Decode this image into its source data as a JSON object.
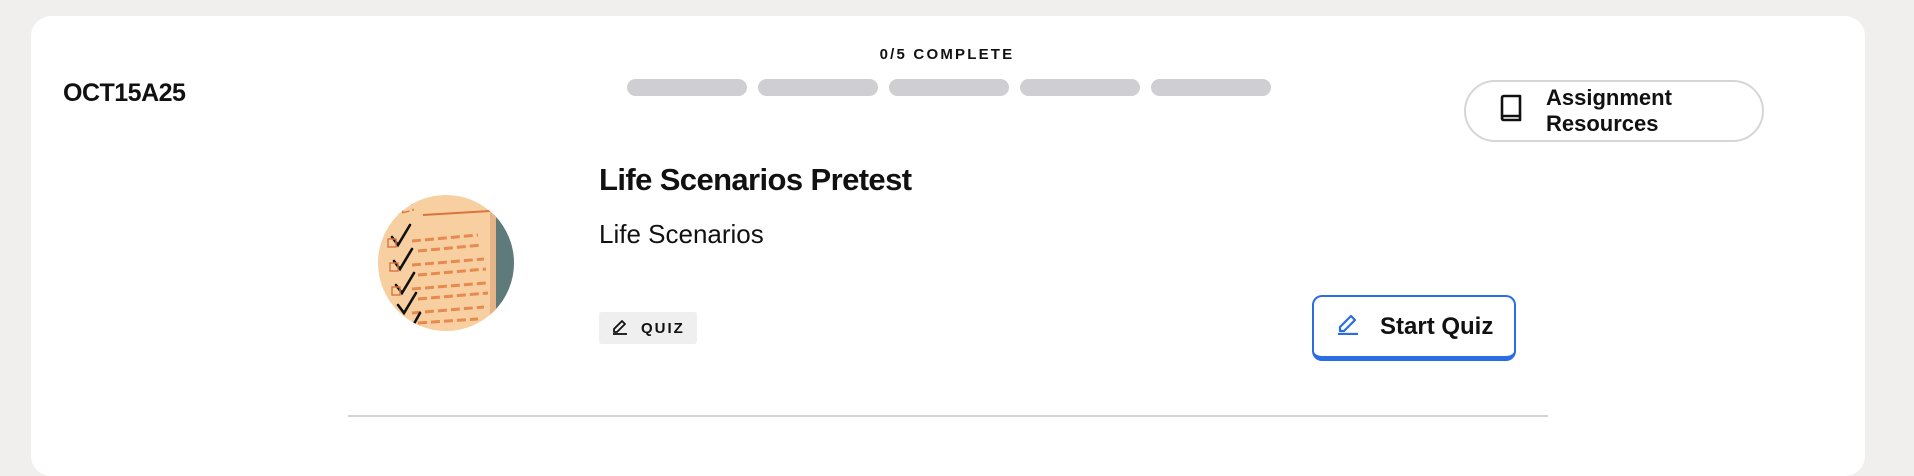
{
  "assignment": {
    "code": "OCT15A25"
  },
  "progress": {
    "label": "0/5 COMPLETE",
    "completed": 0,
    "total": 5
  },
  "resources_button": {
    "label": "Assignment Resources",
    "icon": "book-icon"
  },
  "activity": {
    "title": "Life Scenarios Pretest",
    "subtitle": "Life Scenarios",
    "type_badge": "QUIZ",
    "type_icon": "pencil-icon",
    "thumbnail_icon": "checklist-illustration"
  },
  "start_button": {
    "label": "Start Quiz",
    "icon": "pencil-icon"
  },
  "colors": {
    "accent": "#2b6de4",
    "progress_track": "#cfcfd3",
    "page_bg": "#f0efed",
    "card_bg": "#ffffff"
  }
}
